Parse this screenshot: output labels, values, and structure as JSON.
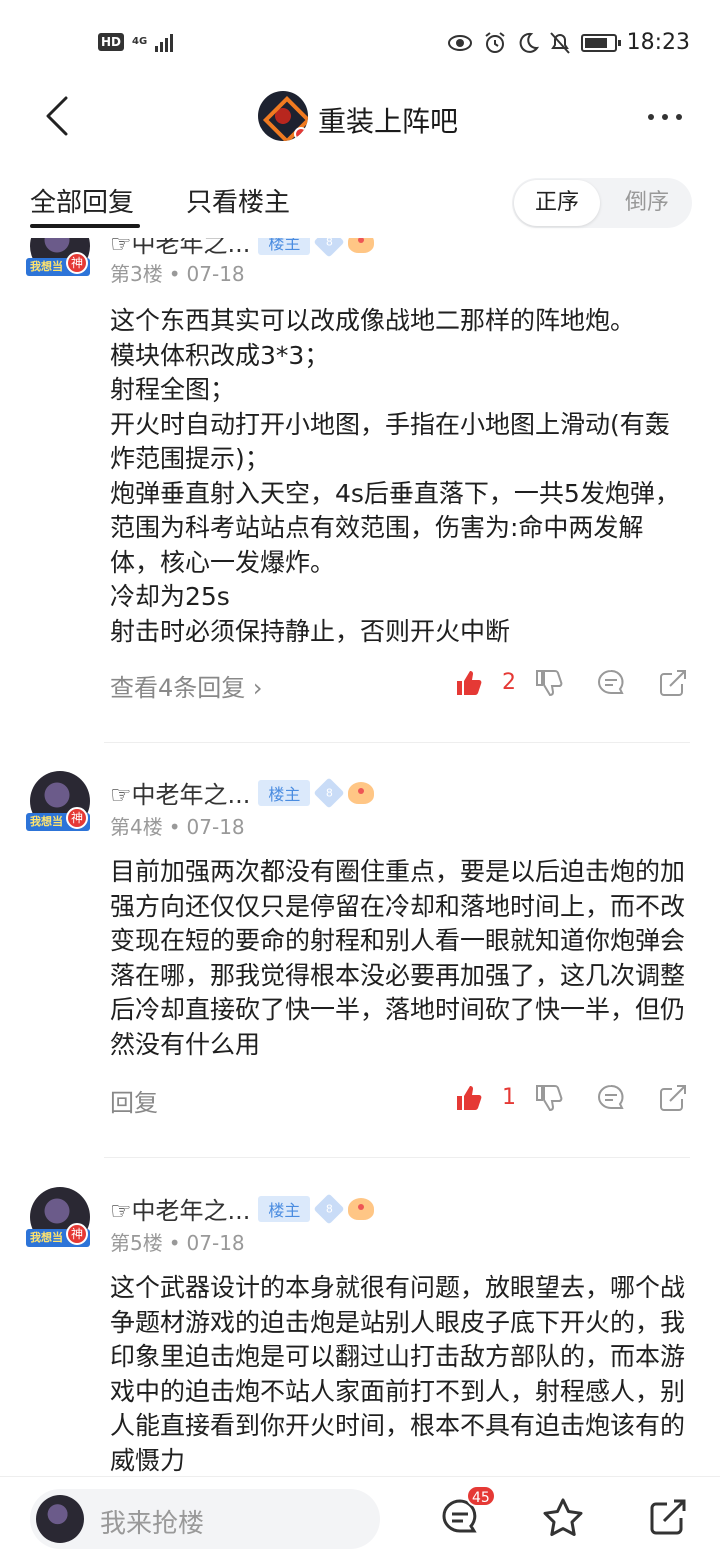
{
  "status_bar": {
    "hd": "HD",
    "network": "4G",
    "time": "18:23"
  },
  "nav": {
    "title": "重装上阵吧"
  },
  "tabs": {
    "all_replies": "全部回复",
    "op_only": "只看楼主",
    "order_asc": "正序",
    "order_desc": "倒序"
  },
  "posts": [
    {
      "username": "☞中老年之...",
      "op_label": "楼主",
      "level": "8",
      "floor": "第3楼",
      "date": "07-18",
      "content": "这个东西其实可以改成像战地二那样的阵地炮。\n模块体积改成3*3；\n射程全图；\n开火时自动打开小地图，手指在小地图上滑动(有轰炸范围提示)；\n炮弹垂直射入天空，4s后垂直落下，一共5发炮弹，范围为科考站站点有效范围，伤害为:命中两发解体，核心一发爆炸。\n冷却为25s\n射击时必须保持静止，否则开火中断",
      "reply_link": "查看4条回复 ›",
      "likes": "2"
    },
    {
      "username": "☞中老年之...",
      "op_label": "楼主",
      "level": "8",
      "floor": "第4楼",
      "date": "07-18",
      "content": "目前加强两次都没有圈住重点，要是以后迫击炮的加强方向还仅仅只是停留在冷却和落地时间上，而不改变现在短的要命的射程和别人看一眼就知道你炮弹会落在哪，那我觉得根本没必要再加强了，这几次调整后冷却直接砍了快一半，落地时间砍了快一半，但仍然没有什么用",
      "reply_link": "回复",
      "likes": "1"
    },
    {
      "username": "☞中老年之...",
      "op_label": "楼主",
      "level": "8",
      "floor": "第5楼",
      "date": "07-18",
      "content": "这个武器设计的本身就很有问题，放眼望去，哪个战争题材游戏的迫击炮是站别人眼皮子底下开火的，我印象里迫击炮是可以翻过山打击敌方部队的，而本游戏中的迫击炮不站人家面前打不到人，射程感人，别人能直接看到你开火时间，根本不具有迫击炮该有的威慑力",
      "reply_link": "",
      "likes": ""
    }
  ],
  "avatar_badge": "我想当",
  "avatar_shen": "神",
  "bottom": {
    "placeholder": "我来抢楼",
    "message_count": "45"
  },
  "colors": {
    "accent_red": "#e53935",
    "op_badge_bg": "#dbe9fb",
    "op_badge_text": "#4a8ce0"
  }
}
